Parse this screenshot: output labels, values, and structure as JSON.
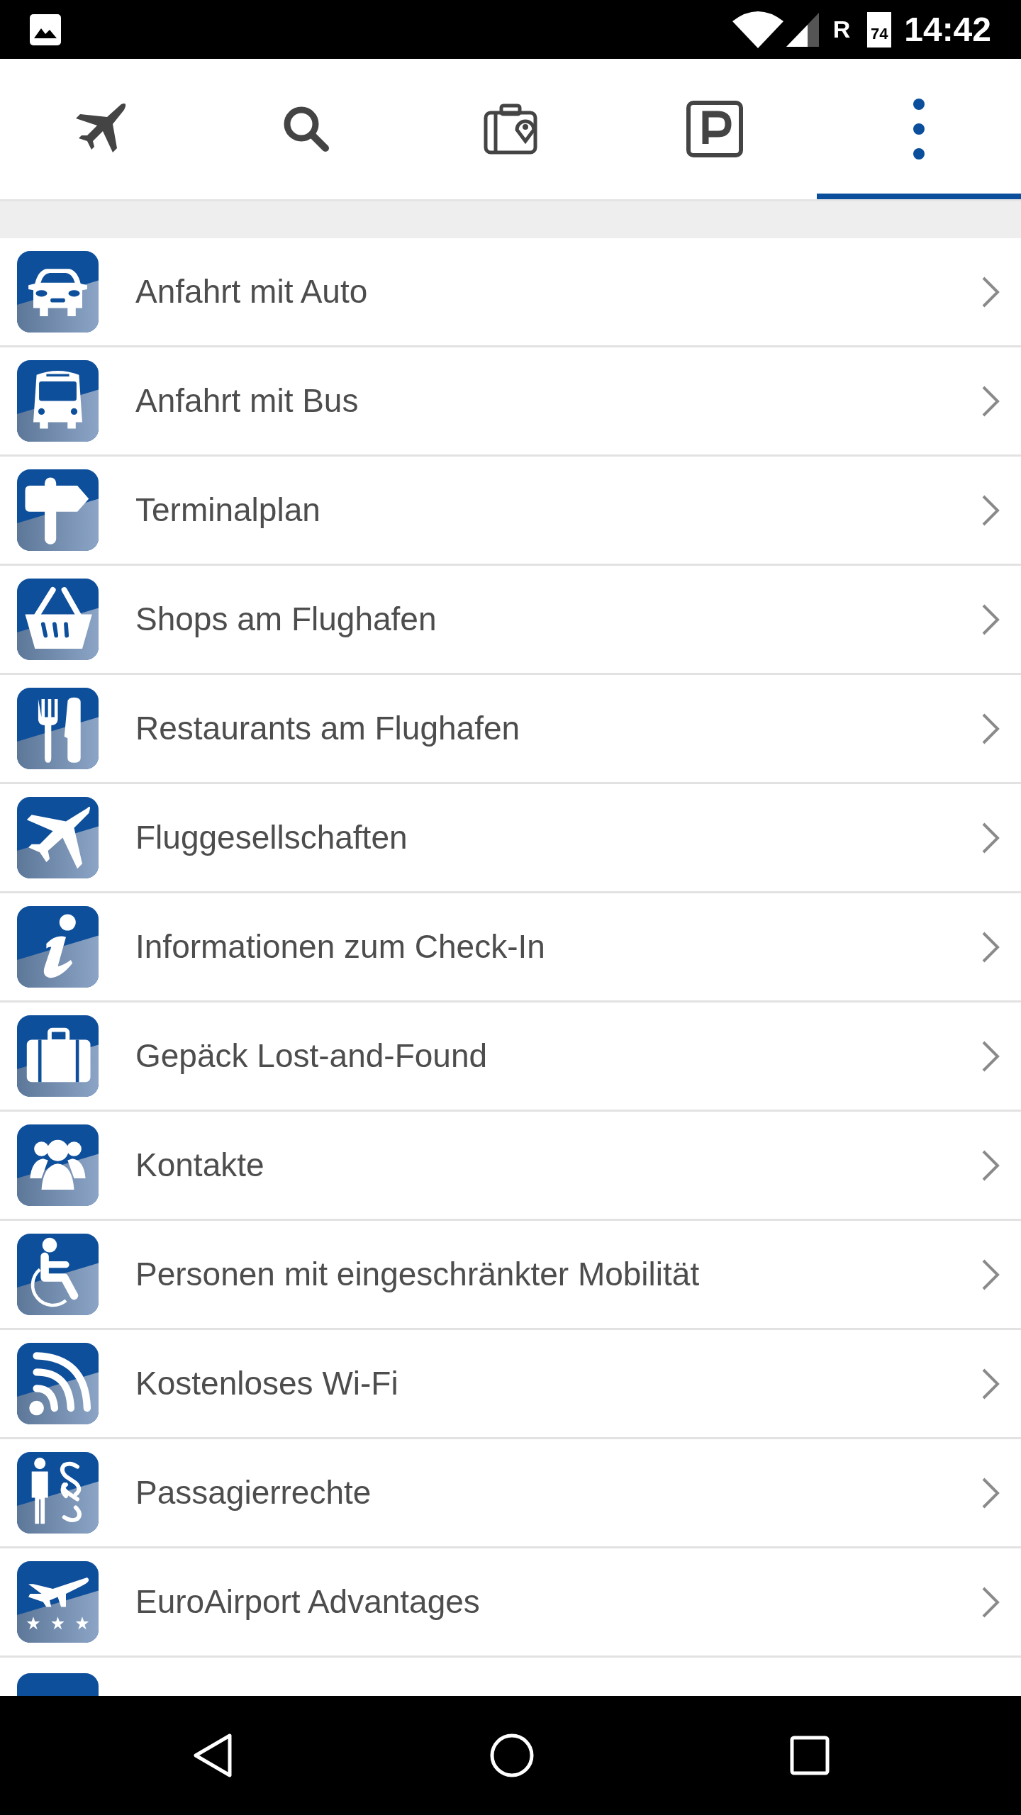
{
  "status_bar": {
    "network": "R",
    "battery": "74",
    "time": "14:42"
  },
  "tabs": [
    {
      "selected": false
    },
    {
      "selected": false
    },
    {
      "selected": false
    },
    {
      "selected": false
    },
    {
      "selected": true
    }
  ],
  "items": [
    {
      "label": "Anfahrt mit Auto"
    },
    {
      "label": "Anfahrt mit Bus"
    },
    {
      "label": "Terminalplan"
    },
    {
      "label": "Shops am Flughafen"
    },
    {
      "label": "Restaurants am Flughafen"
    },
    {
      "label": "Fluggesellschaften"
    },
    {
      "label": "Informationen zum Check-In"
    },
    {
      "label": "Gepäck Lost-and-Found"
    },
    {
      "label": "Kontakte"
    },
    {
      "label": "Personen mit eingeschränkter Mobilität"
    },
    {
      "label": "Kostenloses Wi-Fi"
    },
    {
      "label": "Passagierrechte"
    },
    {
      "label": "EuroAirport Advantages"
    }
  ]
}
